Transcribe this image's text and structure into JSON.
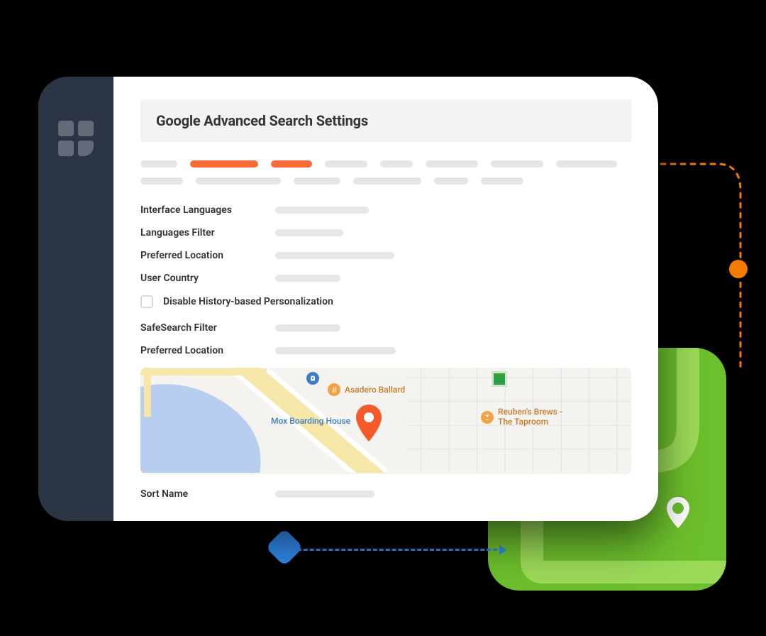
{
  "header": {
    "title": "Google Advanced Search Settings"
  },
  "fields": {
    "interface_languages": "Interface Languages",
    "languages_filter": "Languages Filter",
    "preferred_location": "Preferred Location",
    "user_country": "User Country",
    "safesearch_filter": "SafeSearch Filter",
    "preferred_location_2": "Preferred Location",
    "sort_name": "Sort Name"
  },
  "checkbox": {
    "disable_personalization": "Disable History-based Personalization"
  },
  "map": {
    "poi_asadero": "Asadero Ballard",
    "poi_mox": "Mox Boarding House",
    "poi_reubens_line1": "Reuben's Brews -",
    "poi_reubens_line2": "The Taproom"
  },
  "colors": {
    "accent": "#f76b3a",
    "frame": "#12233d",
    "sidebar": "#2b3544",
    "green": "#6cbf2d",
    "orange": "#f47a00",
    "blue": "#2f86e6"
  }
}
